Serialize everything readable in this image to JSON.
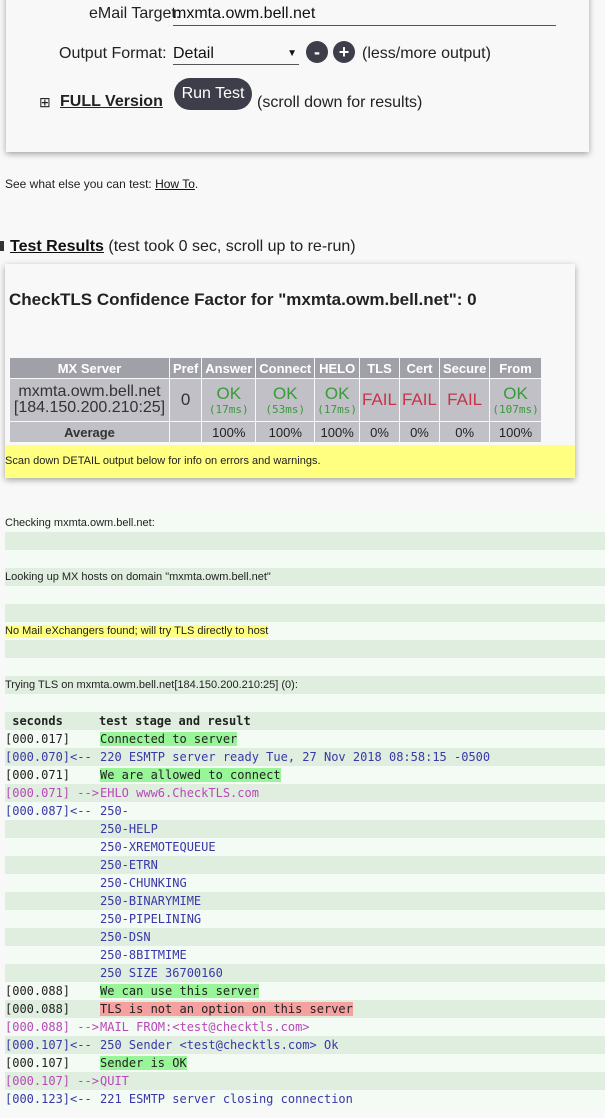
{
  "form": {
    "email_label": "eMail Target:",
    "email_value": "mxmta.owm.bell.net",
    "format_label": "Output Format:",
    "format_value": "Detail",
    "less": "-",
    "more": "+",
    "less_more": "(less/more output)",
    "full_version": "FULL Version",
    "run_test": "Run Test",
    "scroll_hint": "(scroll down for results)"
  },
  "howto": {
    "text": "See what else you can test: ",
    "link": "How To",
    "end": "."
  },
  "results": {
    "link": "Test Results",
    "note": "(test took 0 sec, scroll up to re-run)"
  },
  "card": {
    "title": "CheckTLS Confidence Factor for \"mxmta.owm.bell.net\": 0",
    "headers": [
      "MX Server",
      "Pref",
      "Answer",
      "Connect",
      "HELO",
      "TLS",
      "Cert",
      "Secure",
      "From"
    ],
    "server": "mxmta.owm.bell.net",
    "ip": "[184.150.200.210:25]",
    "pref": "0",
    "cells": [
      {
        "s": "OK",
        "ms": "(17ms)"
      },
      {
        "s": "OK",
        "ms": "(53ms)"
      },
      {
        "s": "OK",
        "ms": "(17ms)"
      },
      {
        "s": "FAIL"
      },
      {
        "s": "FAIL"
      },
      {
        "s": "FAIL"
      },
      {
        "s": "OK",
        "ms": "(107ms)"
      }
    ],
    "avg_label": "Average",
    "avg": [
      "100%",
      "100%",
      "100%",
      "0%",
      "0%",
      "0%",
      "100%"
    ],
    "warning": "Scan down DETAIL output below for info on errors and warnings."
  },
  "log": {
    "pre": [
      "Checking mxmta.owm.bell.net:",
      "",
      "",
      "Looking up MX hosts on domain \"mxmta.owm.bell.net\"",
      "",
      "",
      "No Mail eXchangers found; will try TLS directly to host",
      "",
      "",
      "Trying TLS on mxmta.owm.bell.net[184.150.200.210:25] (0):",
      ""
    ],
    "header": [
      " seconds",
      "test stage and result"
    ],
    "lines": [
      {
        "t": "[000.017]",
        "d": "",
        "m": "Connected to server",
        "k": "ok"
      },
      {
        "t": "[000.070]",
        "d": "<-- ",
        "m": "220 ESMTP server ready Tue, 27 Nov 2018 08:58:15 -0500",
        "k": "in"
      },
      {
        "t": "[000.071]",
        "d": "",
        "m": "We are allowed to connect",
        "k": "ok"
      },
      {
        "t": "[000.071]",
        "d": " -->",
        "m": "EHLO www6.CheckTLS.com",
        "k": "out"
      },
      {
        "t": "[000.087]",
        "d": "<-- ",
        "m": "250-",
        "k": "in"
      },
      {
        "t": "",
        "d": "",
        "m": "250-HELP",
        "k": "in"
      },
      {
        "t": "",
        "d": "",
        "m": "250-XREMOTEQUEUE",
        "k": "in"
      },
      {
        "t": "",
        "d": "",
        "m": "250-ETRN",
        "k": "in"
      },
      {
        "t": "",
        "d": "",
        "m": "250-CHUNKING",
        "k": "in"
      },
      {
        "t": "",
        "d": "",
        "m": "250-BINARYMIME",
        "k": "in"
      },
      {
        "t": "",
        "d": "",
        "m": "250-PIPELINING",
        "k": "in"
      },
      {
        "t": "",
        "d": "",
        "m": "250-DSN",
        "k": "in"
      },
      {
        "t": "",
        "d": "",
        "m": "250-8BITMIME",
        "k": "in"
      },
      {
        "t": "",
        "d": "",
        "m": "250 SIZE 36700160",
        "k": "in"
      },
      {
        "t": "[000.088]",
        "d": "",
        "m": "We can use this server",
        "k": "ok"
      },
      {
        "t": "[000.088]",
        "d": "",
        "m": "TLS is not an option on this server",
        "k": "bad"
      },
      {
        "t": "[000.088]",
        "d": " -->",
        "m": "MAIL FROM:<test@checktls.com>",
        "k": "out"
      },
      {
        "t": "[000.107]",
        "d": "<-- ",
        "m": "250 Sender <test@checktls.com> Ok",
        "k": "in"
      },
      {
        "t": "[000.107]",
        "d": "",
        "m": "Sender is OK",
        "k": "ok"
      },
      {
        "t": "[000.107]",
        "d": " -->",
        "m": "QUIT",
        "k": "out"
      },
      {
        "t": "[000.123]",
        "d": "<-- ",
        "m": "221 ESMTP server closing connection",
        "k": "in"
      }
    ]
  },
  "colors": {
    "ok": "#3a9a3a",
    "fail": "#c8334a",
    "in": "#3838a8",
    "out": "#b848b8",
    "highlight_ok": "#98f598",
    "highlight_bad": "#f7a0a0",
    "warning": "#ffff80"
  }
}
